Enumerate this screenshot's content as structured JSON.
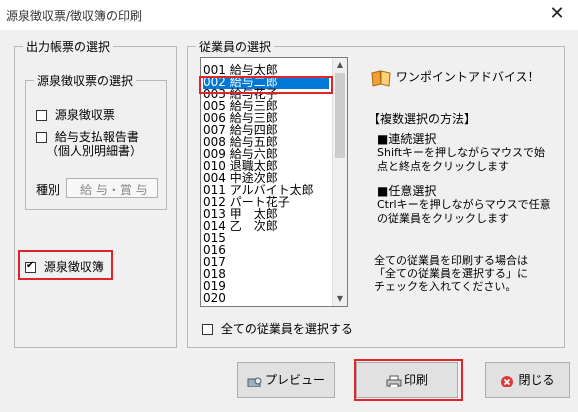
{
  "window": {
    "title": "源泉徴収票/徴収簿の印刷",
    "close_label": "✕"
  },
  "output_group": {
    "title": "出力帳票の選択",
    "sub_group_title": "源泉徴収票の選択",
    "opt_withholding_slip": "源泉徴収票",
    "opt_payment_report_line1": "給与支払報告書",
    "opt_payment_report_line2": "（個人別明細書）",
    "kind_label": "種別",
    "kind_value": "給 与・賞 与",
    "opt_withholding_ledger": "源泉徴収簿"
  },
  "employee_group": {
    "title": "従業員の選択",
    "employees": [
      "001 給与太郎",
      "002 給与二郎",
      "003 給与花子",
      "005 給与三郎",
      "006 給与三郎",
      "007 給与四郎",
      "008 給与五郎",
      "009 給与六郎",
      "010 退職太郎",
      "004 中途次郎",
      "011 アルバイト太郎",
      "012 パート花子",
      "013 甲　太郎",
      "014 乙　次郎",
      "015",
      "016",
      "017",
      "018",
      "019",
      "020"
    ],
    "selected_index": 1,
    "select_all_label": "全ての従業員を選択する"
  },
  "advice": {
    "heading": "ワンポイントアドバイス！",
    "method_title": "【複数選択の方法】",
    "cont_title": "■連続選択",
    "cont_text_1": "Shiftキーを押しながらマウスで始",
    "cont_text_2": "点と終点をクリックします",
    "any_title": "■任意選択",
    "any_text_1": "Ctrlキーを押しながらマウスで任意",
    "any_text_2": "の従業員をクリックします",
    "all_text_1": "全ての従業員を印刷する場合は",
    "all_text_2": "「全ての従業員を選択する」に",
    "all_text_3": "チェックを入れてください。"
  },
  "buttons": {
    "preview": "プレビュー",
    "print": "印刷",
    "close": "閉じる"
  },
  "colors": {
    "highlight": "#e0242c",
    "selection": "#0078d7"
  }
}
